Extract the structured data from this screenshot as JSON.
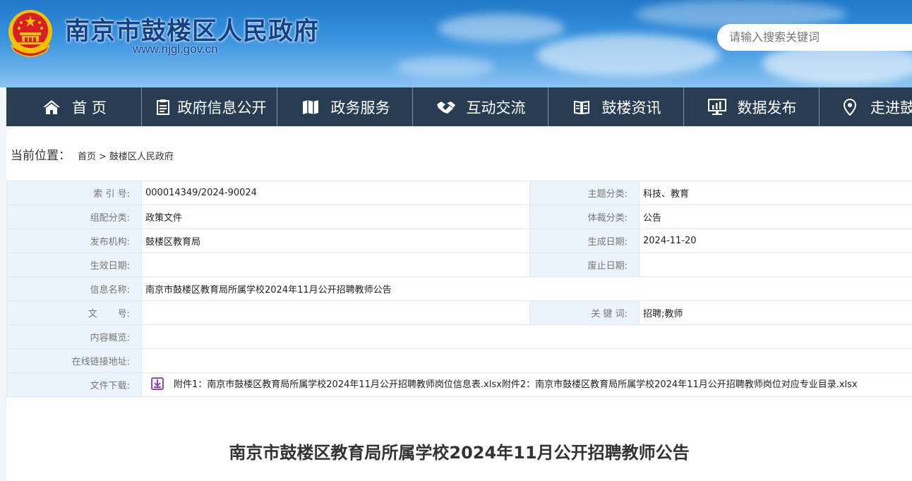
{
  "header": {
    "site_title": "南京市鼓楼区人民政府",
    "site_url": "www.njgl.gov.cn",
    "search_placeholder": "请输入搜索关键词"
  },
  "nav": [
    {
      "label": "首 页",
      "icon": "home-icon"
    },
    {
      "label": "政府信息公开",
      "icon": "document-icon"
    },
    {
      "label": "政务服务",
      "icon": "map-icon"
    },
    {
      "label": "互动交流",
      "icon": "handshake-icon"
    },
    {
      "label": "鼓楼资讯",
      "icon": "book-icon"
    },
    {
      "label": "数据发布",
      "icon": "monitor-chart-icon"
    },
    {
      "label": "走进鼓",
      "icon": "location-pin-icon"
    }
  ],
  "breadcrumb": {
    "label": "当前位置：",
    "items": [
      "首页",
      "鼓楼区人民政府"
    ],
    "separator": ">"
  },
  "meta": {
    "index_label": "索 引 号:",
    "index_value": "000014349/2024-90024",
    "topic_label": "主题分类:",
    "topic_value": "科技、教育",
    "group_label": "组配分类:",
    "group_value": "政策文件",
    "genre_label": "体裁分类:",
    "genre_value": "公告",
    "publisher_label": "发布机构:",
    "publisher_value": "鼓楼区教育局",
    "created_label": "生成日期:",
    "created_value": "2024-11-20",
    "effective_label": "生效日期:",
    "effective_value": "",
    "expiry_label": "废止日期:",
    "expiry_value": "",
    "name_label": "信息名称:",
    "name_value": "南京市鼓楼区教育局所属学校2024年11月公开招聘教师公告",
    "docno_label": "文       号:",
    "docno_value": "",
    "keywords_label": "关 键 词:",
    "keywords_value": "招聘;教师",
    "summary_label": "内容概览:",
    "summary_value": "",
    "link_label": "在线链接地址:",
    "link_value": "",
    "download_label": "文件下载:",
    "attachment1": "附件1：南京市鼓楼区教育局所属学校2024年11月公开招聘教师岗位信息表.xlsx",
    "attachment2": "附件2：南京市鼓楼区教育局所属学校2024年11月公开招聘教师岗位对应专业目录.xlsx"
  },
  "article": {
    "title": "南京市鼓楼区教育局所属学校2024年11月公开招聘教师公告"
  },
  "colors": {
    "nav_bg": "#283c52",
    "label_bg": "#ebf3fc",
    "title_blue": "#12428f",
    "emblem_red": "#d71f26",
    "emblem_gold": "#f5c100",
    "download_purple": "#8c47c8"
  }
}
